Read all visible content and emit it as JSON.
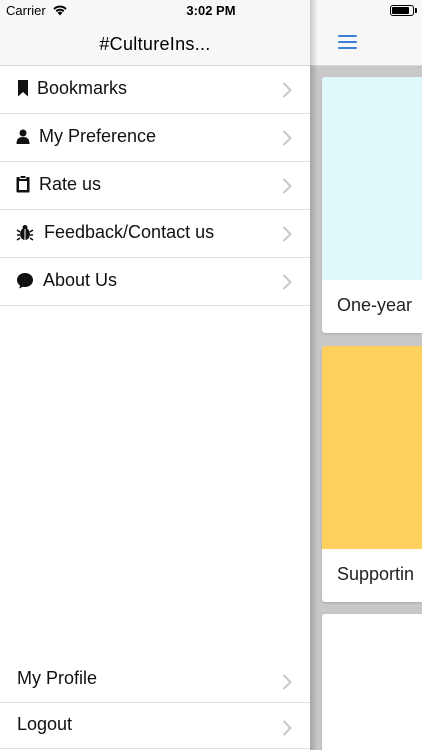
{
  "status_bar": {
    "carrier": "Carrier",
    "time": "3:02 PM"
  },
  "drawer": {
    "title": "#CultureIns...",
    "items": [
      {
        "label": "Bookmarks",
        "icon": "bookmark-icon"
      },
      {
        "label": "My Preference",
        "icon": "person-icon"
      },
      {
        "label": "Rate us",
        "icon": "clipboard-icon"
      },
      {
        "label": "Feedback/Contact us",
        "icon": "bug-icon"
      },
      {
        "label": "About Us",
        "icon": "chat-bubble-icon"
      }
    ],
    "bottom_items": [
      {
        "label": "My Profile"
      },
      {
        "label": "Logout"
      }
    ]
  },
  "main": {
    "menu_icon": "hamburger-icon",
    "cards": [
      {
        "title": "One-year",
        "color": "#dff9fb"
      },
      {
        "title": "Supportin",
        "color": "#fed15f"
      },
      {
        "title": "",
        "color": "#ffffff"
      }
    ]
  },
  "colors": {
    "accent": "#3b7fd9",
    "drawer_header_bg": "#f7f7f7",
    "content_bg": "#c8c8c8"
  }
}
